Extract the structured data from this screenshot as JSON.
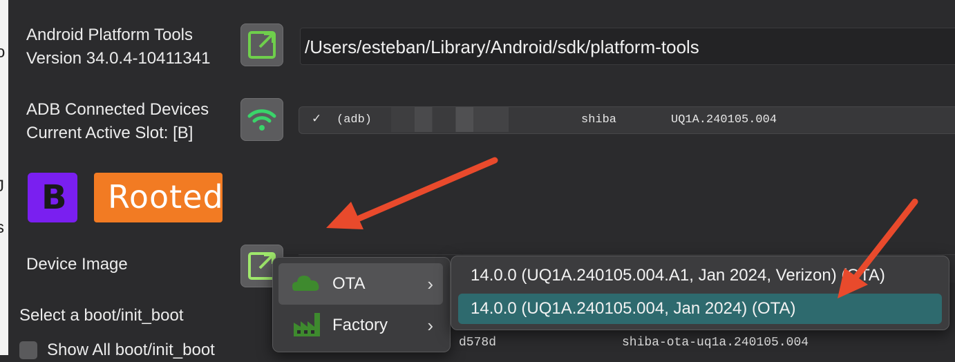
{
  "platform_tools": {
    "title_line1": "Android Platform Tools",
    "title_line2": "Version 34.0.4-10411341",
    "path": "/Users/esteban/Library/Android/sdk/platform-tools"
  },
  "adb": {
    "title_line1": "ADB Connected Devices",
    "title_line2": "Current Active Slot: [B]",
    "device": {
      "check": "✓",
      "mode": "(adb)",
      "codename": "shiba",
      "build": "UQ1A.240105.004"
    }
  },
  "badges": {
    "slot_letter": "B",
    "root_status": "Rooted"
  },
  "device_image": {
    "label": "Device Image"
  },
  "boot": {
    "label": "Select a boot/init_boot",
    "show_all_label": "Show All boot/init_boot",
    "row_hash": "d578d",
    "row_name": "shiba-ota-uq1a.240105.004"
  },
  "menu": {
    "items": [
      {
        "label": "OTA",
        "icon": "cloud-icon"
      },
      {
        "label": "Factory",
        "icon": "factory-icon"
      }
    ],
    "submenu": [
      {
        "label": "14.0.0 (UQ1A.240105.004.A1, Jan 2024, Verizon) (OTA)",
        "selected": false
      },
      {
        "label": "14.0.0 (UQ1A.240105.004, Jan 2024) (OTA)",
        "selected": true
      }
    ],
    "chevron": "›"
  },
  "colors": {
    "highlight": "#2e6a6e",
    "arrow": "#e94a2c",
    "slot_badge": "#7a1ff0",
    "root_badge": "#f27b23",
    "wifi_green": "#3ad46a"
  }
}
